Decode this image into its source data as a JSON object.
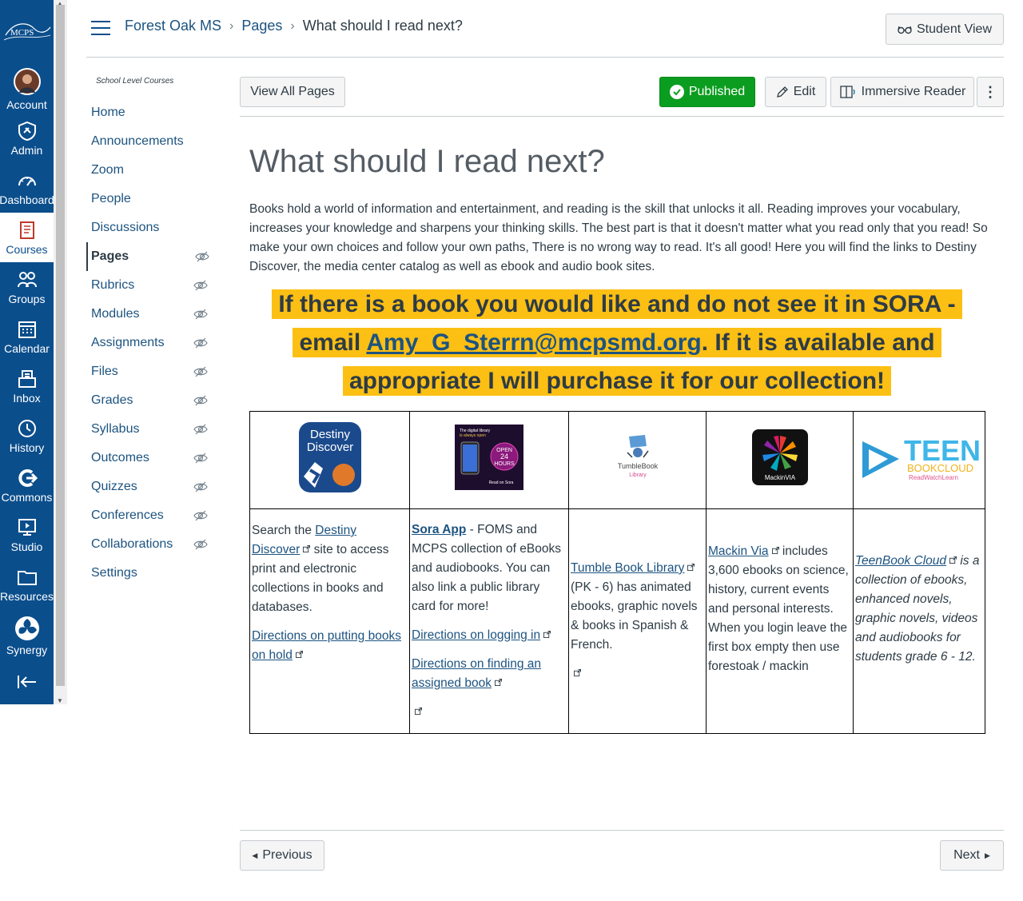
{
  "global_nav": {
    "logo_text": "MCPS",
    "items": [
      {
        "label": "Account",
        "icon": "avatar"
      },
      {
        "label": "Admin",
        "icon": "shield-icon"
      },
      {
        "label": "Dashboard",
        "icon": "dashboard-icon"
      },
      {
        "label": "Courses",
        "icon": "book-icon"
      },
      {
        "label": "Groups",
        "icon": "groups-icon"
      },
      {
        "label": "Calendar",
        "icon": "calendar-icon"
      },
      {
        "label": "Inbox",
        "icon": "inbox-icon"
      },
      {
        "label": "History",
        "icon": "clock-icon"
      },
      {
        "label": "Commons",
        "icon": "commons-icon"
      },
      {
        "label": "Studio",
        "icon": "studio-icon"
      },
      {
        "label": "Resources",
        "icon": "folder-icon"
      },
      {
        "label": "Synergy",
        "icon": "synergy-icon"
      }
    ],
    "active_color": "#c0392b",
    "background": "#0b4e8c"
  },
  "breadcrumb": {
    "course": "Forest Oak MS",
    "section": "Pages",
    "current": "What should I read next?"
  },
  "header": {
    "student_view_label": "Student View"
  },
  "course_nav": {
    "subtitle": "School Level Courses",
    "items": [
      {
        "label": "Home"
      },
      {
        "label": "Announcements"
      },
      {
        "label": "Zoom"
      },
      {
        "label": "People"
      },
      {
        "label": "Discussions"
      },
      {
        "label": "Pages"
      },
      {
        "label": "Rubrics"
      },
      {
        "label": "Modules"
      },
      {
        "label": "Assignments"
      },
      {
        "label": "Files"
      },
      {
        "label": "Grades"
      },
      {
        "label": "Syllabus"
      },
      {
        "label": "Outcomes"
      },
      {
        "label": "Quizzes"
      },
      {
        "label": "Conferences"
      },
      {
        "label": "Collaborations"
      },
      {
        "label": "Settings"
      }
    ]
  },
  "toolbar": {
    "view_all": "View All Pages",
    "published": "Published",
    "edit": "Edit",
    "immersive_reader": "Immersive Reader"
  },
  "page": {
    "title": "What should I read next?",
    "intro": "Books hold a world of information and entertainment, and reading is the skill that unlocks it all. Reading improves your vocabulary, increases your knowledge and sharpens your thinking skills. The best part is that it doesn't matter what you read only that you read! So make your own choices and follow your own paths, There is no wrong way to read. It's all good! Here you will find the links to Destiny Discover, the media center catalog as well as ebook and audio book sites.",
    "highlight_part1": "If there is a book you would like and do not see it in SORA - email ",
    "highlight_email": "Amy_G_Sterrn@mcpsmd.org",
    "highlight_part2": ". If it is available and appropriate I will purchase it for our collection!",
    "highlight_color": "#fcbf14"
  },
  "logos": {
    "destiny": {
      "line1": "Destiny",
      "line2": "Discover"
    },
    "sora": {
      "line1": "The digital library",
      "line2": "is always open",
      "badge1": "OPEN",
      "badge2": "24",
      "badge3": "HOURS",
      "footer": "Read on Sora"
    },
    "tumble": {
      "line1": "TumbleBook",
      "line2": "Library"
    },
    "mackin": {
      "text": "MackinVIA"
    },
    "teen": {
      "big": "TEEN",
      "mid": "BOOKCLOUD",
      "small": "ReadWatchLearn"
    }
  },
  "cells": {
    "destiny": {
      "pre": "Search the ",
      "link": "Destiny Discover",
      "post": " site to access print and electronic collections in books and databases.",
      "link2": "Directions on putting books on hold"
    },
    "sora": {
      "link": "Sora App",
      "post": " - FOMS and MCPS collection of eBooks and audiobooks. You can also link a public library card for more!",
      "link2": "Directions on logging in",
      "link3": "Directions on finding an assigned book"
    },
    "tumble": {
      "link": "Tumble Book Library",
      "post": " (PK - 6) has animated ebooks, graphic novels & books in Spanish & French."
    },
    "mackin": {
      "link": "Mackin Via",
      "post": " includes 3,600 ebooks on science, history, current events and personal interests. When you login leave the first box empty then use forestoak / mackin"
    },
    "teen": {
      "link": "TeenBook Cloud",
      "post": " is a collection of ebooks, enhanced novels, graphic novels, videos and audiobooks for students grade 6 - 12."
    }
  },
  "footer": {
    "previous": "Previous",
    "next": "Next"
  }
}
